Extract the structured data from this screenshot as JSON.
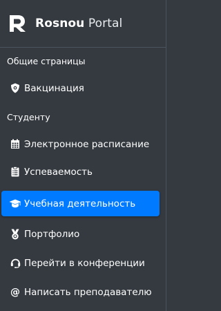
{
  "brand": {
    "name_bold": "Rosnou",
    "name_light": "Portal"
  },
  "sections": {
    "general": "Общие страницы",
    "student": "Студенту"
  },
  "nav": {
    "vaccination": "Вакцинация",
    "schedule": "Электронное расписание",
    "grades": "Успеваемость",
    "activity": "Учебная деятельность",
    "portfolio": "Портфолио",
    "conference": "Перейти в конференции",
    "write_teacher": "Написать преподавателю"
  },
  "colors": {
    "sidebar_bg": "#343a40",
    "active_bg": "#007bff",
    "text": "#ffffff"
  },
  "icons": {
    "vaccination": "shield-virus-icon",
    "schedule": "calendar-icon",
    "grades": "clipboard-list-icon",
    "activity": "graduation-cap-icon",
    "portfolio": "medal-icon",
    "conference": "headset-icon",
    "write_teacher": "at-icon"
  },
  "active_item": "activity"
}
